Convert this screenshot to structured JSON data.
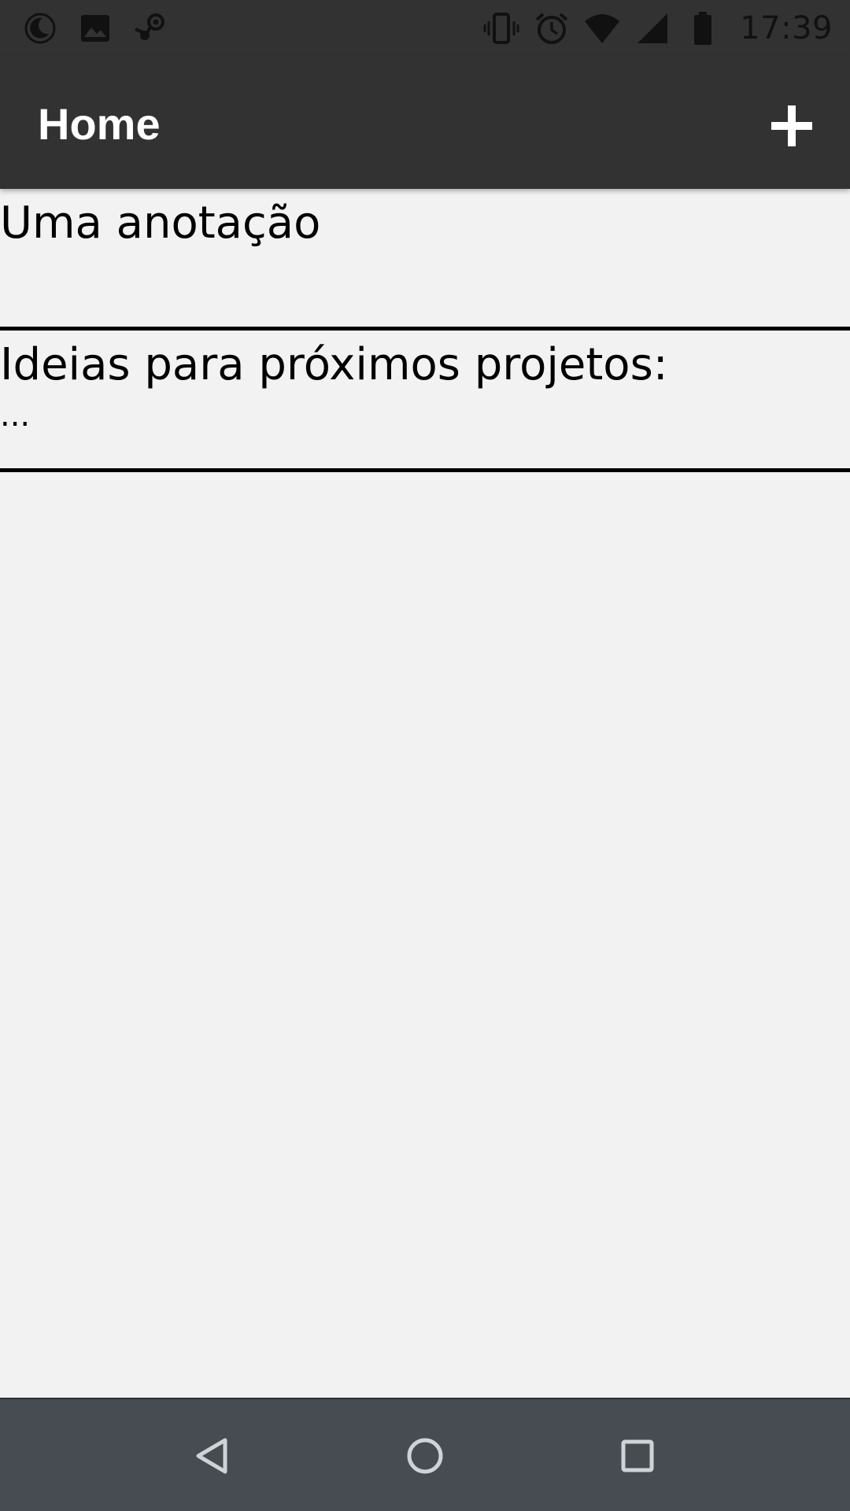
{
  "status_bar": {
    "time": "17:39",
    "left_icons": [
      "do-not-disturb-icon",
      "image-notification-icon",
      "steam-icon"
    ],
    "right_icons": [
      "vibrate-icon",
      "alarm-icon",
      "wifi-icon",
      "cell-signal-icon",
      "battery-icon"
    ]
  },
  "app_bar": {
    "title": "Home",
    "add_icon": "plus-icon"
  },
  "notes": [
    {
      "title": "Uma anotação",
      "body": ""
    },
    {
      "title": "Ideias para próximos projetos:",
      "body": "..."
    }
  ],
  "nav_bar": {
    "icons": [
      "back-icon",
      "home-icon",
      "recents-icon"
    ]
  },
  "colors": {
    "bar_background": "#323232",
    "content_background": "#f2f2f2",
    "nav_background": "#464c52",
    "divider": "#000000",
    "title_text": "#ffffff"
  }
}
